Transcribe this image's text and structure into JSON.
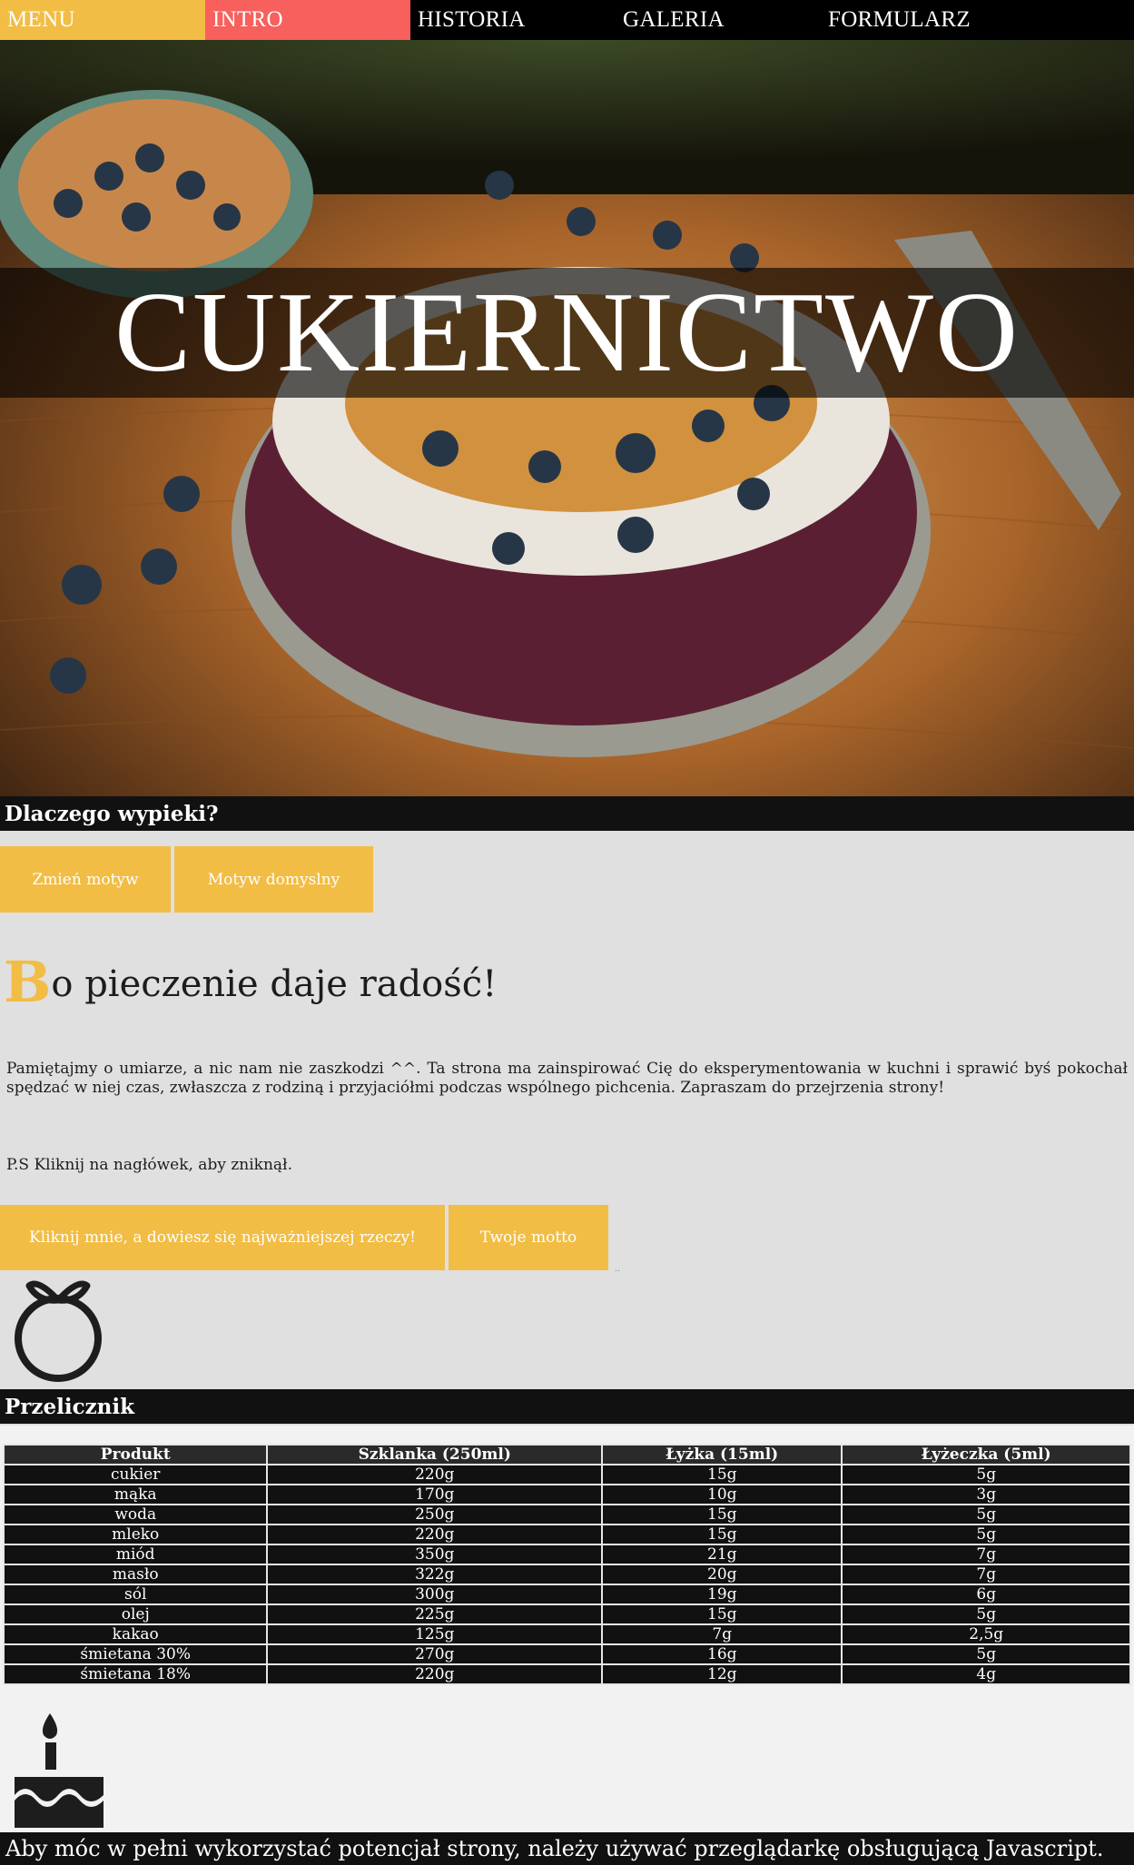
{
  "nav": {
    "items": [
      {
        "label": "MENU"
      },
      {
        "label": "INTRO"
      },
      {
        "label": "HISTORIA"
      },
      {
        "label": "GALERIA"
      },
      {
        "label": "FORMULARZ"
      }
    ]
  },
  "hero": {
    "title": "CUKIERNICTWO"
  },
  "section1": {
    "title": "Dlaczego wypieki?"
  },
  "theme_buttons": {
    "change": "Zmień motyw",
    "default": "Motyw domyslny"
  },
  "lead": {
    "cap": "B",
    "rest": "o pieczenie daje radość!"
  },
  "paragraph": "Pamiętajmy o umiarze, a nic nam nie zaszkodzi ^^. Ta strona ma zainspirować Cię do eksperymentowania w kuchni i sprawić byś pokochał spędzać w niej czas, zwłaszcza z rodziną i przyjaciółmi podczas wspólnego pichcenia. Zapraszam do przejrzenia strony!",
  "ps": "P.S Kliknij na nagłówek, aby zniknął.",
  "action_buttons": {
    "important": "Kliknij mnie, a dowiesz się najważniejszej rzeczy!",
    "motto": "Twoje motto"
  },
  "dots": "..",
  "section2": {
    "title": "Przelicznik"
  },
  "table": {
    "headers": [
      "Produkt",
      "Szklanka (250ml)",
      "Łyżka (15ml)",
      "Łyżeczka (5ml)"
    ],
    "rows": [
      [
        "cukier",
        "220g",
        "15g",
        "5g"
      ],
      [
        "mąka",
        "170g",
        "10g",
        "3g"
      ],
      [
        "woda",
        "250g",
        "15g",
        "5g"
      ],
      [
        "mleko",
        "220g",
        "15g",
        "5g"
      ],
      [
        "miód",
        "350g",
        "21g",
        "7g"
      ],
      [
        "masło",
        "322g",
        "20g",
        "7g"
      ],
      [
        "sól",
        "300g",
        "19g",
        "6g"
      ],
      [
        "olej",
        "225g",
        "15g",
        "5g"
      ],
      [
        "kakao",
        "125g",
        "7g",
        "2,5g"
      ],
      [
        "śmietana 30%",
        "270g",
        "16g",
        "5g"
      ],
      [
        "śmietana 18%",
        "220g",
        "12g",
        "4g"
      ]
    ]
  },
  "footer": "Aby móc w pełni wykorzystać potencjał strony, należy używać przeglądarkę obsługującą Javascript.",
  "icons": {
    "top": "orange-fruit-icon",
    "bottom": "birthday-cake-icon"
  },
  "colors": {
    "accent": "#f2bd45",
    "active": "#f7605c",
    "dark": "#111111"
  }
}
